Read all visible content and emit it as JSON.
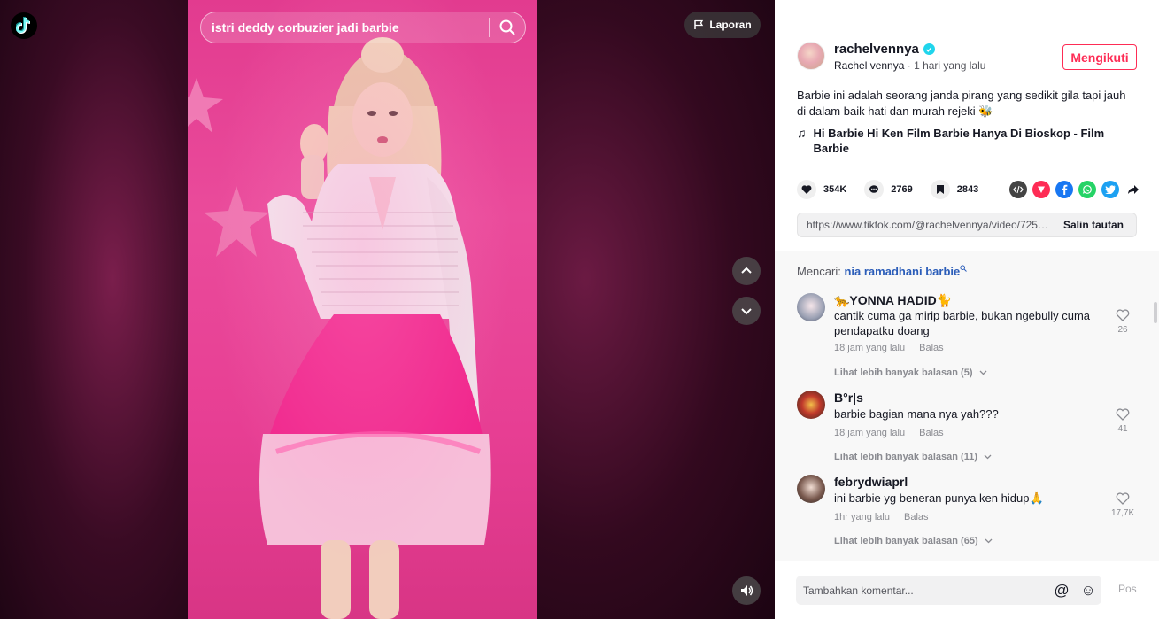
{
  "search": {
    "query": "istri deddy corbuzier jadi barbie"
  },
  "video": {
    "report_label": "Laporan"
  },
  "author": {
    "username": "rachelvennya",
    "display_name": "Rachel vennya",
    "separator": " · ",
    "posted": "1 hari yang lalu",
    "follow_label": "Mengikuti"
  },
  "post": {
    "description": "Barbie ini adalah seorang janda pirang yang sedikit gila tapi jauh di dalam baik hati dan murah rejeki 🐝",
    "music_icon": "♫",
    "music": "Hi Barbie Hi Ken Film Barbie Hanya Di Bioskop - Film Barbie"
  },
  "stats": {
    "likes": "354K",
    "comments": "2769",
    "saves": "2843"
  },
  "share": {
    "icons": [
      "embed-icon",
      "send-icon",
      "facebook-icon",
      "whatsapp-icon",
      "twitter-icon",
      "forward-icon"
    ],
    "colors": {
      "embed": "#444444",
      "send": "#fe2c55",
      "facebook": "#1877f2",
      "whatsapp": "#25d366",
      "twitter": "#1da1f2"
    }
  },
  "link": {
    "url": "https://www.tiktok.com/@rachelvennya/video/7259...",
    "copy_label": "Salin tautan"
  },
  "related": {
    "prefix": "Mencari: ",
    "keyword": "nia ramadhani barbie"
  },
  "comments": [
    {
      "name": "🐆YONNA HADID🐈",
      "text": "cantik cuma ga mirip barbie, bukan ngebully cuma pendapatku doang",
      "time": "18 jam yang lalu",
      "reply": "Balas",
      "likes": "26",
      "more": "Lihat lebih banyak balasan (5)"
    },
    {
      "name": "B°r|s",
      "text": "barbie bagian mana nya yah???",
      "time": "18 jam yang lalu",
      "reply": "Balas",
      "likes": "41",
      "more": "Lihat lebih banyak balasan (11)"
    },
    {
      "name": "febrydwiaprl",
      "text": "ini barbie yg beneran punya ken hidup🙏",
      "time": "1hr yang lalu",
      "reply": "Balas",
      "likes": "17,7K",
      "more": "Lihat lebih banyak balasan (65)"
    }
  ],
  "composer": {
    "placeholder": "Tambahkan komentar...",
    "mention_icon": "@",
    "emoji_icon": "☺",
    "post_label": "Pos"
  },
  "colors": {
    "accent": "#fe2c55",
    "link": "#2b5db9",
    "video_bg": "#e23b8f"
  }
}
